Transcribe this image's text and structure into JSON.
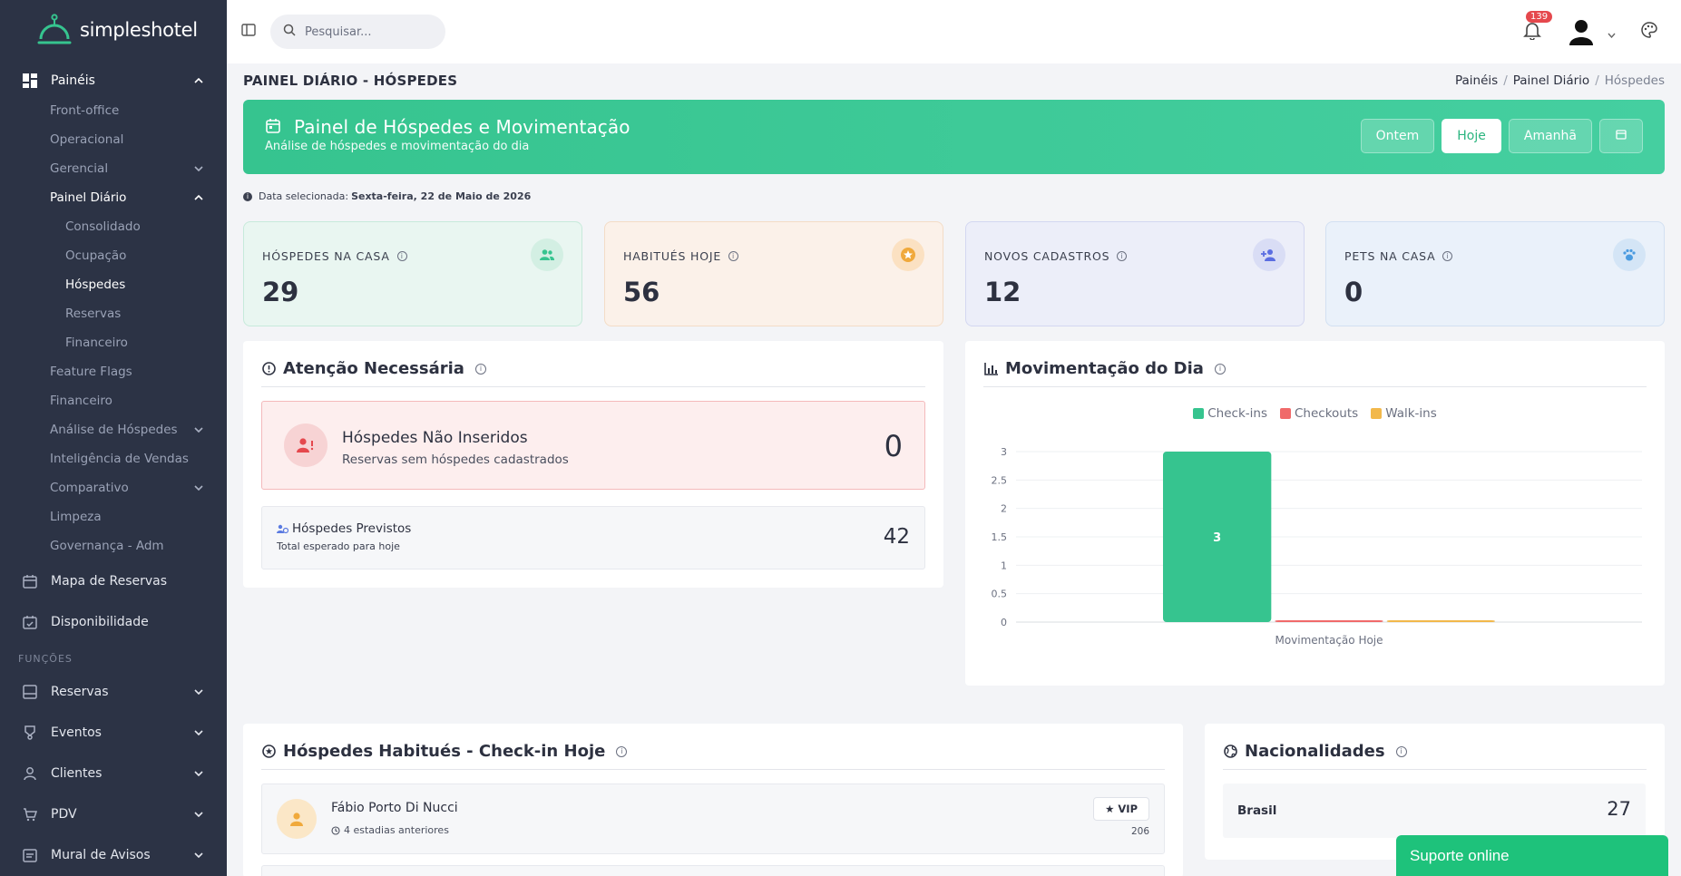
{
  "app": {
    "brand": "simpleshotel"
  },
  "sidebar": {
    "paineis": {
      "label": "Painéis",
      "icon": "dashboard-icon"
    },
    "paineis_items": [
      {
        "label": "Front-office"
      },
      {
        "label": "Operacional"
      },
      {
        "label": "Gerencial"
      },
      {
        "label": "Painel Diário"
      }
    ],
    "painel_diario_items": [
      {
        "label": "Consolidado"
      },
      {
        "label": "Ocupação"
      },
      {
        "label": "Hóspedes"
      },
      {
        "label": "Reservas"
      },
      {
        "label": "Financeiro"
      }
    ],
    "more_items": [
      {
        "label": "Feature Flags"
      },
      {
        "label": "Financeiro"
      },
      {
        "label": "Análise de Hóspedes"
      },
      {
        "label": "Inteligência de Vendas"
      },
      {
        "label": "Comparativo"
      },
      {
        "label": "Limpeza"
      },
      {
        "label": "Governança - Adm"
      }
    ],
    "mapa": {
      "label": "Mapa de Reservas"
    },
    "disponibilidade": {
      "label": "Disponibilidade"
    },
    "funcoes_heading": "FUNÇÕES",
    "funcoes": [
      {
        "label": "Reservas",
        "icon": "reservas-icon"
      },
      {
        "label": "Eventos",
        "icon": "eventos-icon"
      },
      {
        "label": "Clientes",
        "icon": "clientes-icon"
      },
      {
        "label": "PDV",
        "icon": "cart-icon"
      },
      {
        "label": "Mural de Avisos",
        "icon": "mural-icon"
      }
    ]
  },
  "topbar": {
    "search_placeholder": "Pesquisar...",
    "notification_count": "139"
  },
  "page": {
    "title": "PAINEL DIÁRIO - HÓSPEDES",
    "breadcrumb": [
      "Painéis",
      "Painel Diário",
      "Hóspedes"
    ]
  },
  "hero": {
    "title": "Painel de Hóspedes e Movimentação",
    "subtitle": "Análise de hóspedes e movimentação do dia",
    "buttons": {
      "ontem": "Ontem",
      "hoje": "Hoje",
      "amanha": "Amanhã"
    }
  },
  "selected_date": {
    "label": "Data selecionada:",
    "value": "Sexta-feira, 22 de Maio de 2026"
  },
  "stats": [
    {
      "label": "HÓSPEDES NA CASA",
      "value": "29",
      "icon": "users-icon",
      "color": "#36c48f"
    },
    {
      "label": "HABITUÉS HOJE",
      "value": "56",
      "icon": "star-icon",
      "color": "#f0a93b"
    },
    {
      "label": "NOVOS CADASTROS",
      "value": "12",
      "icon": "user-plus-icon",
      "color": "#5b6ee1"
    },
    {
      "label": "PETS NA CASA",
      "value": "0",
      "icon": "paw-icon",
      "color": "#4b9be0"
    }
  ],
  "attention": {
    "title": "Atenção Necessária",
    "alert_title": "Hóspedes Não Inseridos",
    "alert_subtitle": "Reservas sem hóspedes cadastrados",
    "alert_value": "0",
    "prev_title": "Hóspedes Previstos",
    "prev_subtitle": "Total esperado para hoje",
    "prev_value": "42"
  },
  "movimentacao": {
    "title": "Movimentação do Dia"
  },
  "chart_data": {
    "type": "bar",
    "categories": [
      "Movimentação Hoje"
    ],
    "series": [
      {
        "name": "Check-ins",
        "values": [
          3
        ],
        "color": "#36c48f"
      },
      {
        "name": "Checkouts",
        "values": [
          0
        ],
        "color": "#f06a6a"
      },
      {
        "name": "Walk-ins",
        "values": [
          0
        ],
        "color": "#f2b84b"
      }
    ],
    "data_labels": [
      "3"
    ],
    "yticks": [
      "0",
      "0.5",
      "1",
      "1.5",
      "2",
      "2.5",
      "3"
    ],
    "ylim": [
      0,
      3
    ],
    "legend": "top",
    "grid": true
  },
  "habitues": {
    "title": "Hóspedes Habitués - Check-in Hoje",
    "row": {
      "name": "Fábio Porto Di Nucci",
      "stays": "4 estadias anteriores",
      "badge": "★ VIP",
      "number": "206"
    }
  },
  "nacionalidades": {
    "title": "Nacionalidades",
    "row": {
      "country": "Brasil",
      "value": "27"
    }
  },
  "support": {
    "label": "Suporte online"
  }
}
